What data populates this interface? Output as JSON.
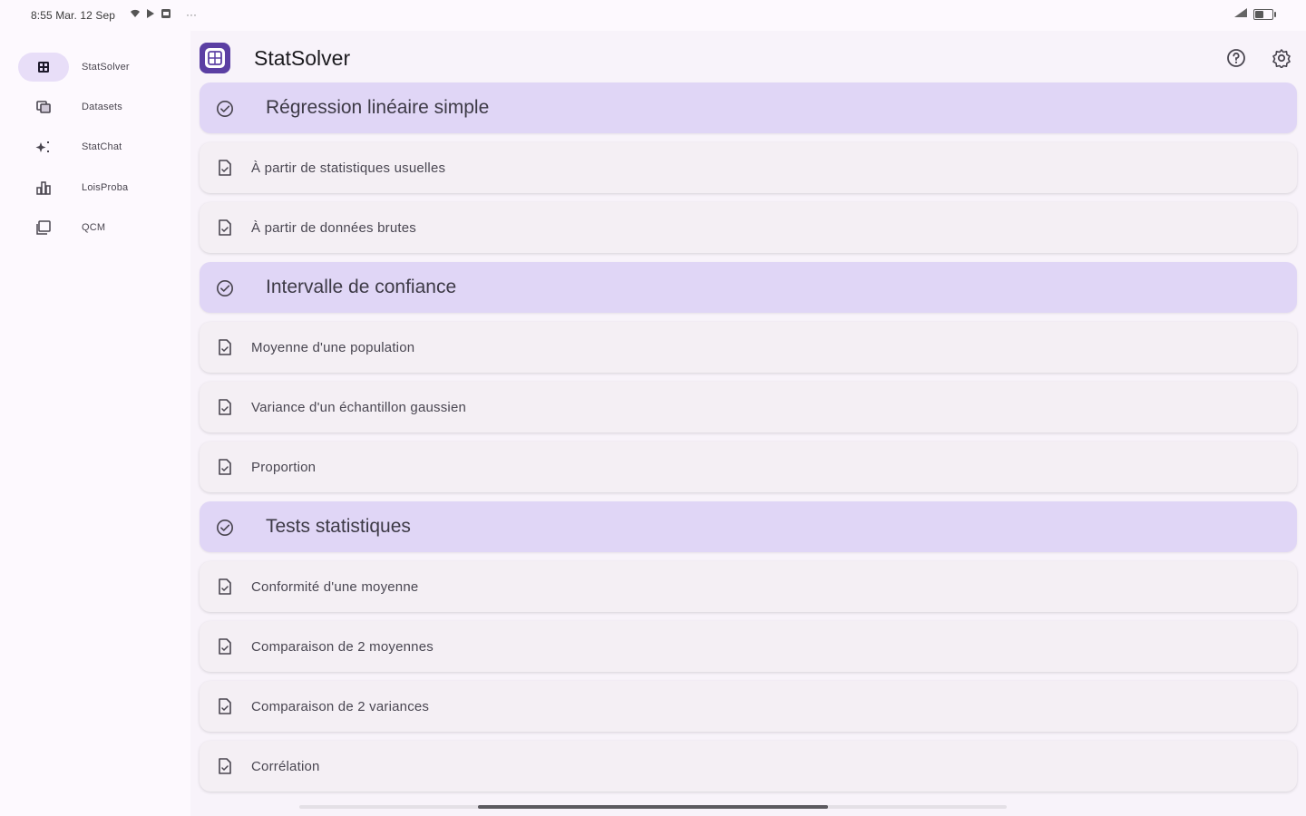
{
  "status_bar": {
    "time": "8:55 Mar. 12 Sep",
    "left_icons": [
      "wifi-bars-icon",
      "play-icon",
      "sim-card-icon"
    ],
    "overflow": "···",
    "right_icons": [
      "signal-icon",
      "battery-icon"
    ]
  },
  "nav_rail": {
    "items": [
      {
        "label": "StatSolver",
        "icon": "calculator-icon",
        "active": true
      },
      {
        "label": "Datasets",
        "icon": "database-icon",
        "active": false
      },
      {
        "label": "StatChat",
        "icon": "sparkle-icon",
        "active": false
      },
      {
        "label": "LoisProba",
        "icon": "bar-chart-icon",
        "active": false
      },
      {
        "label": "QCM",
        "icon": "quiz-icon",
        "active": false
      }
    ]
  },
  "header": {
    "title": "StatSolver",
    "logo_icon": "calculator-logo-icon",
    "actions": [
      {
        "name": "help-button",
        "icon": "help-circle-icon"
      },
      {
        "name": "settings-button",
        "icon": "gear-icon"
      }
    ]
  },
  "list": {
    "entries": [
      {
        "type": "section",
        "label": "Régression linéaire simple"
      },
      {
        "type": "item",
        "label": "À partir de statistiques usuelles"
      },
      {
        "type": "item",
        "label": "À partir de données brutes"
      },
      {
        "type": "section",
        "label": "Intervalle de confiance"
      },
      {
        "type": "item",
        "label": "Moyenne d'une population"
      },
      {
        "type": "item",
        "label": "Variance d'un échantillon gaussien"
      },
      {
        "type": "item",
        "label": "Proportion"
      },
      {
        "type": "section",
        "label": "Tests statistiques"
      },
      {
        "type": "item",
        "label": "Conformité d'une moyenne"
      },
      {
        "type": "item",
        "label": "Comparaison de 2 moyennes"
      },
      {
        "type": "item",
        "label": "Comparaison de 2 variances"
      },
      {
        "type": "item",
        "label": "Corrélation"
      }
    ]
  },
  "colors": {
    "section_bg": "#e0d6f6",
    "item_bg": "#f4eff4",
    "active_pill": "#e8def8",
    "logo": "#5b3fa3"
  }
}
